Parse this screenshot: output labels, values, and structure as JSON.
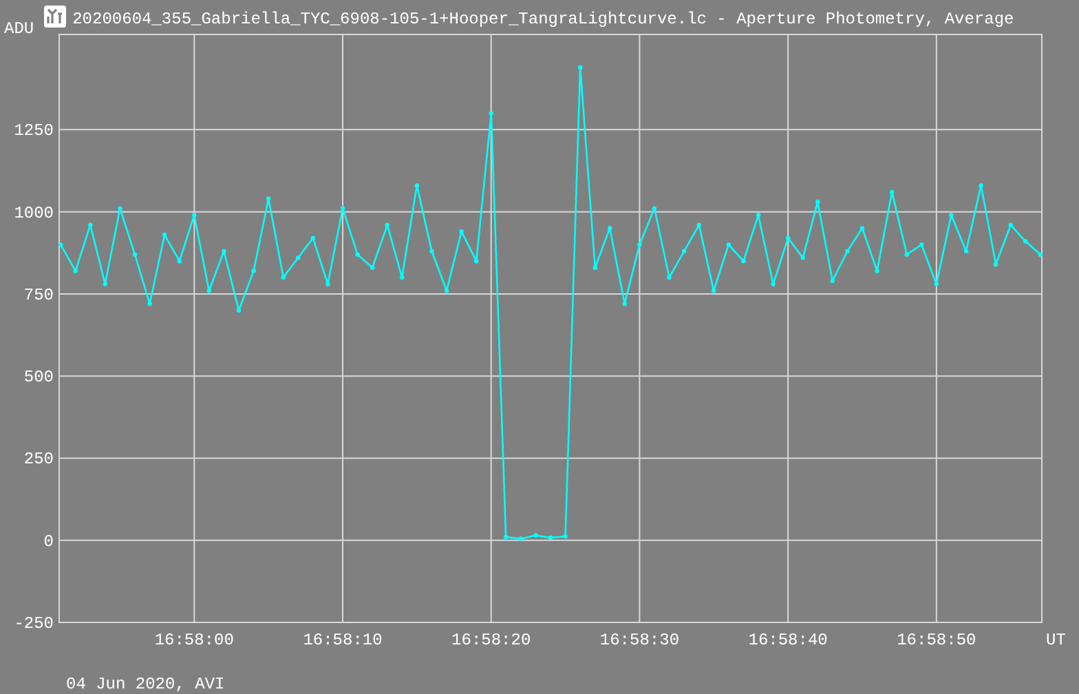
{
  "window": {
    "title": "20200604_355_Gabriella_TYC_6908-105-1+Hooper_TangraLightcurve.lc - Aperture Photometry, Average"
  },
  "chart": {
    "chart_data": {
      "type": "line",
      "xlabel": "UT",
      "ylabel": "ADU",
      "grid": true,
      "categories": [
        null,
        null,
        null,
        null,
        null,
        null,
        null,
        null,
        null,
        "16:58:00",
        null,
        null,
        null,
        null,
        null,
        null,
        null,
        null,
        null,
        "16:58:10",
        null,
        null,
        null,
        null,
        null,
        null,
        null,
        null,
        null,
        "16:58:20",
        null,
        null,
        null,
        null,
        null,
        null,
        null,
        null,
        null,
        "16:58:30",
        null,
        null,
        null,
        null,
        null,
        null,
        null,
        null,
        null,
        "16:58:40",
        null,
        null,
        null,
        null,
        null,
        null,
        null,
        null,
        null,
        "16:58:50",
        null,
        null,
        null,
        null,
        null,
        null,
        null
      ],
      "series": [
        {
          "color": "#00ffff",
          "marker": "circle",
          "values": [
            900,
            820,
            960,
            780,
            1010,
            870,
            720,
            930,
            850,
            990,
            760,
            880,
            700,
            820,
            1040,
            800,
            860,
            920,
            780,
            1010,
            870,
            830,
            960,
            800,
            1080,
            880,
            760,
            940,
            850,
            1300,
            10,
            5,
            15,
            8,
            12,
            1440,
            830,
            950,
            720,
            900,
            1010,
            800,
            880,
            960,
            760,
            900,
            850,
            990,
            780,
            920,
            860,
            1030,
            790,
            880,
            950,
            820,
            1060,
            870,
            900,
            780,
            990,
            880,
            1080,
            840,
            960,
            910,
            870
          ]
        }
      ],
      "ylim": [
        -250,
        1540
      ],
      "yticks": [
        -250,
        0,
        250,
        500,
        750,
        1000,
        1250
      ]
    }
  },
  "footer": {
    "text": "04 Jun 2020, AVI"
  }
}
